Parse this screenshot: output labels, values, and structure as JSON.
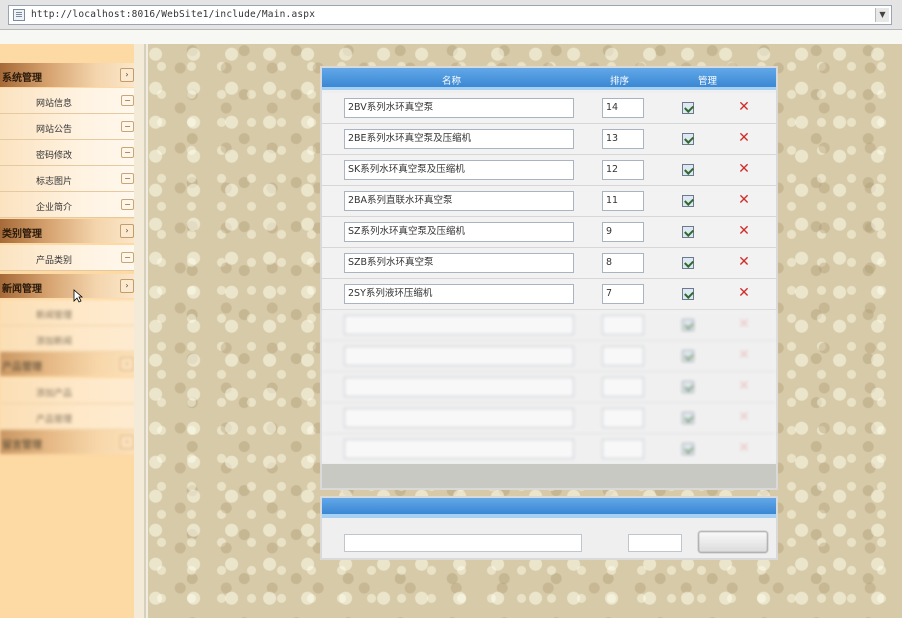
{
  "browser": {
    "url": "http://localhost:8016/WebSite1/include/Main.aspx"
  },
  "sidebar": {
    "sections": [
      {
        "label": "系统管理",
        "items": [
          "网站信息",
          "网站公告",
          "密码修改",
          "标志图片",
          "企业简介"
        ]
      },
      {
        "label": "类别管理",
        "items": [
          "产品类别"
        ]
      },
      {
        "label": "新闻管理",
        "items": [
          "新闻管理",
          "添加新闻"
        ]
      },
      {
        "label": "产品管理",
        "items": [
          "添加产品",
          "产品管理"
        ]
      },
      {
        "label": "留言管理",
        "items": []
      }
    ]
  },
  "table": {
    "headers": {
      "name": "名称",
      "seq": "排序",
      "op": "管理"
    },
    "rows": [
      {
        "name": "2BV系列水环真空泵",
        "seq": "14"
      },
      {
        "name": "2BE系列水环真空泵及压缩机",
        "seq": "13"
      },
      {
        "name": "SK系列水环真空泵及压缩机",
        "seq": "12"
      },
      {
        "name": "2BA系列直联水环真空泵",
        "seq": "11"
      },
      {
        "name": "SZ系列水环真空泵及压缩机",
        "seq": "9"
      },
      {
        "name": "SZB系列水环真空泵",
        "seq": "8"
      },
      {
        "name": "2SY系列液环压缩机",
        "seq": "7"
      },
      {
        "name": "",
        "seq": ""
      },
      {
        "name": "",
        "seq": ""
      },
      {
        "name": "",
        "seq": ""
      },
      {
        "name": "",
        "seq": ""
      },
      {
        "name": "",
        "seq": ""
      }
    ],
    "footer": ""
  },
  "add_form": {
    "title": "",
    "button": ""
  },
  "colors": {
    "header_blue": "#3b87d3",
    "sidebar_bg": "#fdd9a4",
    "delete_red": "#d12c2c"
  }
}
